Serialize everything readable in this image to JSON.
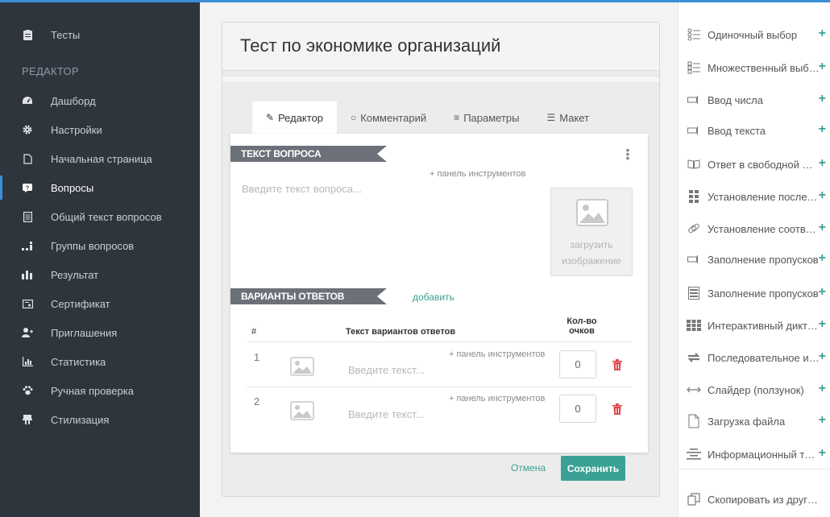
{
  "sidebar": {
    "top_item": "Тесты",
    "section": "РЕДАКТОР",
    "items": [
      {
        "label": "Дашборд",
        "icon": "dashboard-icon"
      },
      {
        "label": "Настройки",
        "icon": "gear-icon"
      },
      {
        "label": "Начальная страница",
        "icon": "file-icon"
      },
      {
        "label": "Вопросы",
        "icon": "question-icon"
      },
      {
        "label": "Общий текст вопросов",
        "icon": "document-icon"
      },
      {
        "label": "Группы вопросов",
        "icon": "groups-icon"
      },
      {
        "label": "Результат",
        "icon": "bar-chart-icon"
      },
      {
        "label": "Сертификат",
        "icon": "certificate-icon"
      },
      {
        "label": "Приглашения",
        "icon": "add-user-icon"
      },
      {
        "label": "Статистика",
        "icon": "stats-icon"
      },
      {
        "label": "Ручная проверка",
        "icon": "paw-icon"
      },
      {
        "label": "Стилизация",
        "icon": "brush-icon"
      }
    ]
  },
  "main": {
    "title": "Тест по экономике организаций",
    "tabs": [
      {
        "label": "Редактор",
        "icon": "edit-icon"
      },
      {
        "label": "Комментарий",
        "icon": "comment-icon"
      },
      {
        "label": "Параметры",
        "icon": "sliders-icon"
      },
      {
        "label": "Макет",
        "icon": "layout-icon"
      }
    ],
    "question_ribbon": "ТЕКСТ ВОПРОСА",
    "toolbar_link": "+ панель инструментов",
    "question_placeholder": "Введите текст вопроса...",
    "upload_line1": "загрузить",
    "upload_line2": "изображение",
    "answers_ribbon": "ВАРИАНТЫ ОТВЕТОВ",
    "add_label": "добавить",
    "table": {
      "col_num": "#",
      "col_text": "Текст вариантов ответов",
      "col_score_line1": "Кол-во",
      "col_score_line2": "очков"
    },
    "answers": [
      {
        "num": "1",
        "placeholder": "Введите текст...",
        "toolbar": "+ панель инструментов",
        "score": "0"
      },
      {
        "num": "2",
        "placeholder": "Введите текст...",
        "toolbar": "+ панель инструментов",
        "score": "0"
      }
    ],
    "cancel_label": "Отмена",
    "save_label": "Сохранить"
  },
  "question_types": [
    {
      "label": "Одиночный выбор",
      "icon": "single-choice-icon"
    },
    {
      "label": "Множественный выбор",
      "icon": "multiple-choice-icon"
    },
    {
      "label": "Ввод числа",
      "icon": "number-input-icon"
    },
    {
      "label": "Ввод текста",
      "icon": "text-input-icon"
    },
    {
      "label": "Ответ в свободной форме",
      "icon": "book-icon"
    },
    {
      "label": "Установление последовательности",
      "icon": "sequence-icon"
    },
    {
      "label": "Установление соответствия",
      "icon": "link-icon"
    },
    {
      "label": "Заполнение пропусков",
      "icon": "fill-gap-icon"
    },
    {
      "label": "Заполнение пропусков",
      "icon": "fill-gap-list-icon"
    },
    {
      "label": "Интерактивный диктант",
      "icon": "grid-icon"
    },
    {
      "label": "Последовательное исключение",
      "icon": "swap-icon"
    },
    {
      "label": "Слайдер (ползунок)",
      "icon": "slider-icon"
    },
    {
      "label": "Загрузка файла",
      "icon": "file-upload-icon"
    },
    {
      "label": "Информационный текст",
      "icon": "align-center-icon"
    }
  ],
  "copy_from": {
    "label": "Скопировать из других тестов",
    "icon": "copy-icon"
  },
  "colors": {
    "accent": "#3aa194",
    "sidebar_bg": "#2f353d",
    "ribbon": "#6c7179",
    "topline": "#3b8fd6"
  }
}
